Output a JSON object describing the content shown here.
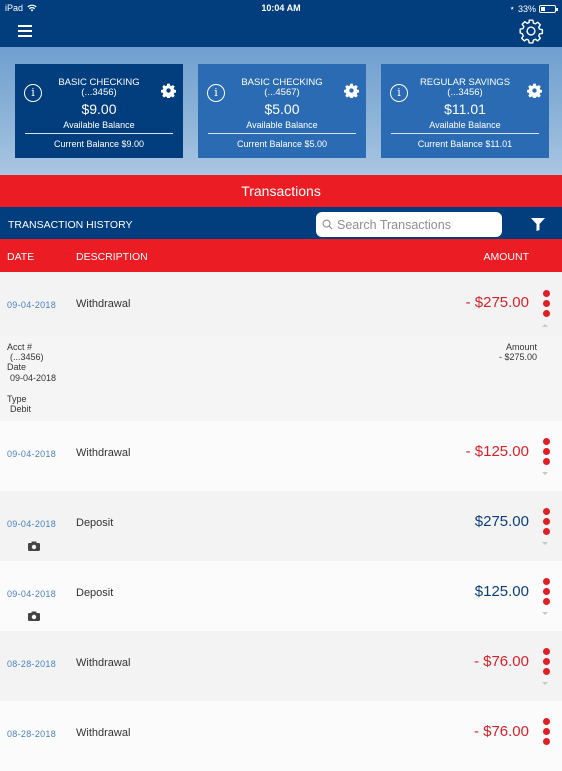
{
  "status_bar": {
    "device": "iPad",
    "time": "10:04 AM",
    "battery": "33%"
  },
  "accounts": [
    {
      "name": "BASIC CHECKING",
      "acct": "(...3456)",
      "available_amount": "$9.00",
      "available_label": "Available Balance",
      "current": "Current Balance $9.00",
      "selected": true
    },
    {
      "name": "BASIC CHECKING",
      "acct": "(...4567)",
      "available_amount": "$5.00",
      "available_label": "Available Balance",
      "current": "Current Balance $5.00",
      "selected": false
    },
    {
      "name": "REGULAR SAVINGS",
      "acct": "(...3456)",
      "available_amount": "$11.01",
      "available_label": "Available Balance",
      "current": "Current Balance $11.01",
      "selected": false
    }
  ],
  "section_title": "Transactions",
  "history": {
    "title": "TRANSACTION HISTORY",
    "search_placeholder": "Search Transactions",
    "search_value": ""
  },
  "columns": {
    "date": "DATE",
    "description": "DESCRIPTION",
    "amount": "AMOUNT"
  },
  "transactions": [
    {
      "date": "09-04-2018",
      "description": "Withdrawal",
      "amount": "- $275.00",
      "type": "neg",
      "has_image": false,
      "expanded": true
    },
    {
      "date": "09-04-2018",
      "description": "Withdrawal",
      "amount": "- $125.00",
      "type": "neg",
      "has_image": false,
      "expanded": false
    },
    {
      "date": "09-04-2018",
      "description": "Deposit",
      "amount": "$275.00",
      "type": "pos",
      "has_image": true,
      "expanded": false
    },
    {
      "date": "09-04-2018",
      "description": "Deposit",
      "amount": "$125.00",
      "type": "pos",
      "has_image": true,
      "expanded": false
    },
    {
      "date": "08-28-2018",
      "description": "Withdrawal",
      "amount": "- $76.00",
      "type": "neg",
      "has_image": false,
      "expanded": false
    },
    {
      "date": "08-28-2018",
      "description": "Withdrawal",
      "amount": "- $76.00",
      "type": "neg",
      "has_image": false,
      "expanded": false
    }
  ],
  "detail": {
    "acct_label": "Acct #",
    "acct_value": "(...3456)",
    "date_label": "Date",
    "date_value": "09-04-2018",
    "type_label": "Type",
    "type_value": "Debit",
    "amount_label": "Amount",
    "amount_value": "- $275.00"
  },
  "colors": {
    "navy": "#023d7e",
    "red": "#ec1c24",
    "card_blue": "#2a6bb4",
    "negative": "#d6232b",
    "positive": "#0b3f7a",
    "date_blue": "#4b82c0"
  }
}
